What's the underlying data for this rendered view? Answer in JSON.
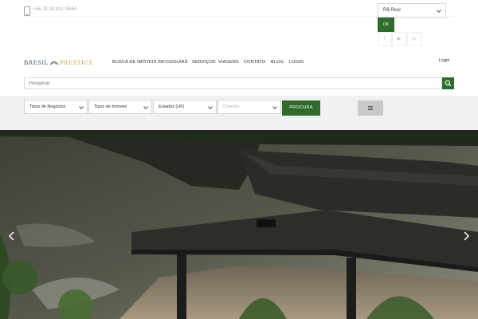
{
  "topbar": {
    "phone": "+55 11 91321-9684",
    "currency_selected": "R$ Real",
    "ok_label": "OK",
    "social": [
      {
        "icon": "facebook-icon",
        "glyph": "f"
      },
      {
        "icon": "youtube-icon",
        "glyph": "▶"
      },
      {
        "icon": "instagram-icon",
        "glyph": "◎"
      }
    ]
  },
  "logo": {
    "left": "BRESIL",
    "right": "PRESTIGE"
  },
  "nav": {
    "items": [
      "BUSCA DE IMÓVEIS",
      "INFOS/GUIAS",
      "SERVIÇOS",
      "VIAGENS",
      "CONTATO",
      "BLOG",
      "LOGIN"
    ],
    "login": "Login"
  },
  "search": {
    "placeholder": "Pesquisar"
  },
  "filters": {
    "tipos_negocios": "Tipos de Negócios",
    "tipos_imoveis": "Tipos de Imóveis",
    "estados": "Estados (UF)",
    "cidades": "Cidades",
    "submit": "PROCURA"
  },
  "colors": {
    "brand_green": "#2f6b2d",
    "filter_band": "#f1f1f1"
  }
}
